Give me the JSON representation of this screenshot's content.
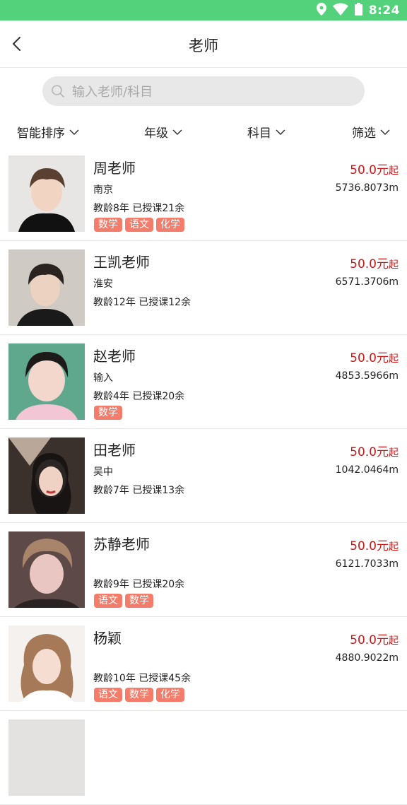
{
  "status_bar": {
    "time": "8:24",
    "icons": [
      "location-icon",
      "wifi-icon",
      "battery-icon"
    ]
  },
  "header": {
    "title": "老师",
    "back_icon": "chevron-left-icon"
  },
  "search": {
    "placeholder": "输入老师/科目",
    "value": ""
  },
  "filters": [
    {
      "label": "智能排序"
    },
    {
      "label": "年级"
    },
    {
      "label": "科目"
    },
    {
      "label": "筛选"
    }
  ],
  "teachers": [
    {
      "name": "周老师",
      "price": "50.0元",
      "price_suffix": "起",
      "city": "南京",
      "distance": "5736.8073m",
      "experience": "教龄8年 已授课21余",
      "subjects": [
        "数学",
        "语文",
        "化学"
      ]
    },
    {
      "name": "王凯老师",
      "price": "50.0元",
      "price_suffix": "起",
      "city": "淮安",
      "distance": "6571.3706m",
      "experience": "教龄12年 已授课12余",
      "subjects": []
    },
    {
      "name": "赵老师",
      "price": "50.0元",
      "price_suffix": "起",
      "city": "输入",
      "distance": "4853.5966m",
      "experience": "教龄4年 已授课20余",
      "subjects": [
        "数学"
      ]
    },
    {
      "name": "田老师",
      "price": "50.0元",
      "price_suffix": "起",
      "city": "吴中",
      "distance": "1042.0464m",
      "experience": "教龄7年 已授课13余",
      "subjects": []
    },
    {
      "name": "苏静老师",
      "price": "50.0元",
      "price_suffix": "起",
      "city": "",
      "distance": "6121.7033m",
      "experience": "教龄9年 已授课20余",
      "subjects": [
        "语文",
        "数学"
      ]
    },
    {
      "name": "杨颖",
      "price": "50.0元",
      "price_suffix": "起",
      "city": "",
      "distance": "4880.9022m",
      "experience": "教龄10年 已授课45余",
      "subjects": [
        "语文",
        "数学",
        "化学"
      ]
    }
  ],
  "colors": {
    "status_bar": "#53d27b",
    "price": "#c81919",
    "tag": "#f47c6a"
  }
}
